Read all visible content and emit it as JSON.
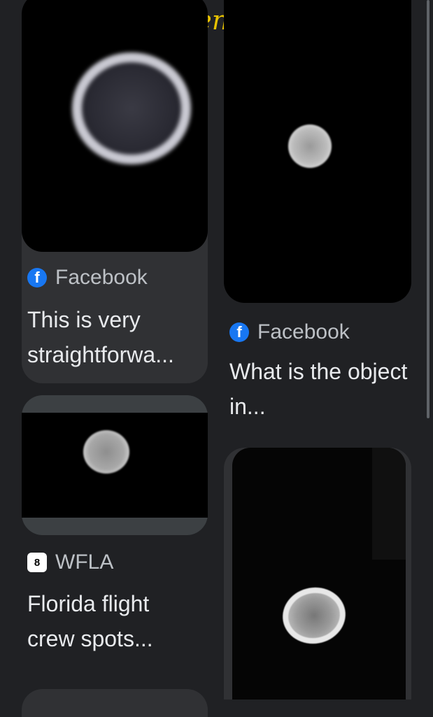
{
  "annotation": {
    "text": "Lens"
  },
  "results": [
    {
      "source": "Facebook",
      "title": "This is very straightforwa..."
    },
    {
      "source": "Facebook",
      "title": "What is the object in..."
    },
    {
      "source": "WFLA",
      "title": "Florida flight crew spots..."
    }
  ],
  "colors": {
    "background": "#202124",
    "card": "#303134",
    "facebook_blue": "#1877f2"
  }
}
